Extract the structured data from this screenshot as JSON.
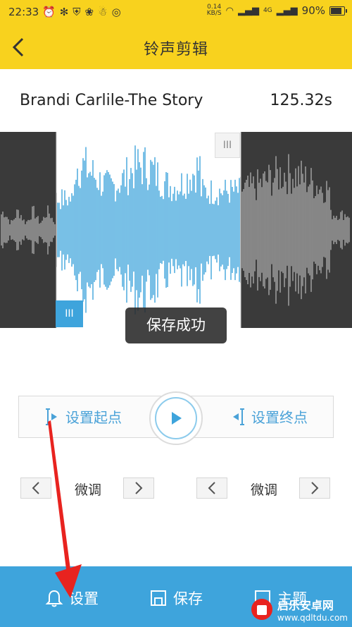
{
  "status_bar": {
    "time": "22:33",
    "net_speed_value": "0.14",
    "net_speed_unit": "KB/S",
    "network": "4G",
    "battery": "90%",
    "battery_level": 0.9
  },
  "header": {
    "title": "铃声剪辑"
  },
  "song": {
    "title": "Brandi Carlile-The Story",
    "duration": "125.32s"
  },
  "waveform": {
    "selected_color": "#3ea4dc",
    "unselected_color": "#a8a8a8",
    "handle_top_glyph": "III",
    "handle_bottom_glyph": "III"
  },
  "toast": {
    "text": "保存成功"
  },
  "controls": {
    "set_start_label": "设置起点",
    "set_end_label": "设置终点"
  },
  "fine_tune": {
    "start_label": "微调",
    "end_label": "微调"
  },
  "bottom_bar": {
    "settings_label": "设置",
    "save_label": "保存",
    "third_label": "主题"
  },
  "watermark": {
    "name": "启乐安卓网",
    "url": "www.qdltdu.com"
  },
  "colors": {
    "accent_yellow": "#f8d21e",
    "accent_blue": "#3ea4dc",
    "annotation_red": "#e8231f"
  }
}
